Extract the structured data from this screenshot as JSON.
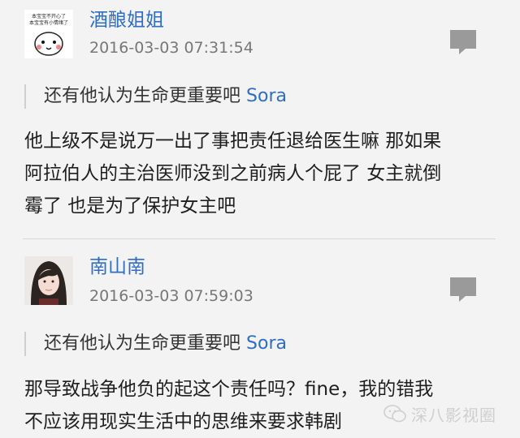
{
  "comments": [
    {
      "author": "酒酿姐姐",
      "timestamp": "2016-03-03 07:31:54",
      "avatar_caption": [
        "本宝宝不开心了",
        "本宝宝有小情绪了"
      ],
      "quote_text": "还有他认为生命更重要吧",
      "quote_author": "Sora",
      "body_lines": [
        "他上级不是说万一出了事把责任退给医生嘛 那如果",
        "阿拉伯人的主治医师没到之前病人个屁了 女主就倒",
        "霉了 也是为了保护女主吧"
      ]
    },
    {
      "author": "南山南",
      "timestamp": "2016-03-03 07:59:03",
      "quote_text": "还有他认为生命更重要吧",
      "quote_author": "Sora",
      "body_lines": [
        "那导致战争他负的起这个责任吗？fine，我的错我",
        "不应该用现实生活中的思维来要求韩剧"
      ]
    }
  ],
  "watermark": {
    "text": "深八影视圈",
    "icon": "wechat-icon"
  },
  "colors": {
    "name_blue": "#2f6ec8",
    "timestamp_gray": "#777777",
    "background": "#f3f3f3"
  }
}
